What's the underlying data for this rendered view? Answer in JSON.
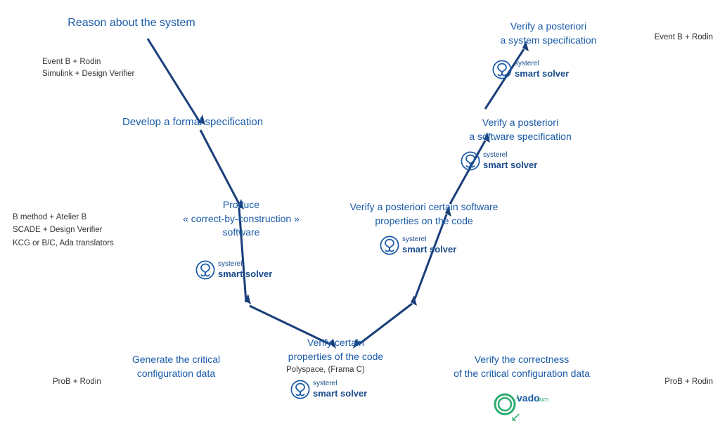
{
  "nodes": {
    "reason_title": "Reason about the system",
    "reason_tools": "Event B + Rodin\nSimulink + Design Verifier",
    "formal_spec": "Develop a formal specification",
    "produce_title": "Produce\n« correct-by-construction »\nsoftware",
    "left_tools": "B method + Atelier B\nSCADE + Design Verifier\nKCG or B/C, Ada translators",
    "verify_system_spec": "Verify a posteriori\na system specification",
    "event_b_rodin_top": "Event B + Rodin",
    "verify_software_spec": "Verify a posteriori\na software specification",
    "verify_software_props": "Verify a posteriori certain software\nproperties on the code",
    "verify_certain": "Verify certain\nproperties of the code",
    "polyspace": "Polyspace, (Frama C)",
    "generate_critical": "Generate the critical\nconfiguration data",
    "prob_rodin_left": "ProB + Rodin",
    "verify_correctness": "Verify the correctness\nof the critical configuration data",
    "prob_rodin_right": "ProB + Rodin",
    "systerel_label_top": "systerel",
    "smart_solver_label": "smart solver"
  },
  "colors": {
    "dark_blue": "#1a3f7a",
    "medium_blue": "#1a5ba8",
    "text_dark": "#222",
    "line_color": "#1a3f7a"
  }
}
